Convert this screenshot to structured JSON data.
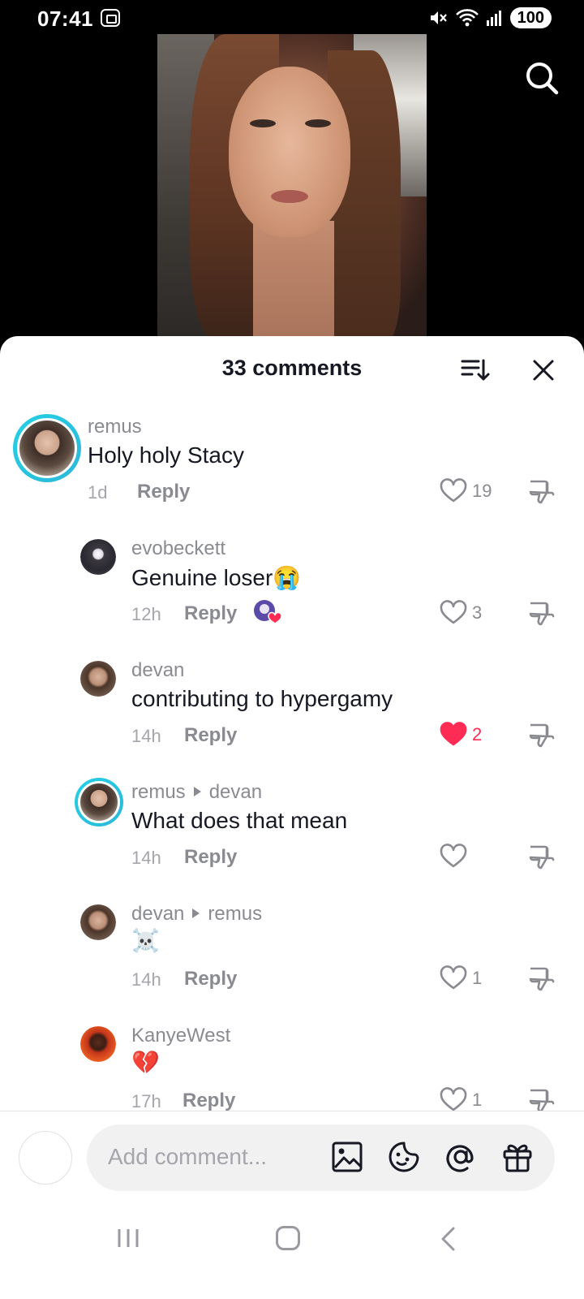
{
  "status_bar": {
    "time": "07:41",
    "battery": "100"
  },
  "sheet": {
    "title": "33 comments"
  },
  "comments": [
    {
      "user": "remus",
      "reply_to": "",
      "text": "Holy holy Stacy",
      "time": "1d",
      "reply_label": "Reply",
      "likes": "19",
      "liked": false
    },
    {
      "user": "evobeckett",
      "reply_to": "",
      "text": "Genuine loser😭",
      "time": "12h",
      "reply_label": "Reply",
      "likes": "3",
      "liked": false
    },
    {
      "user": "devan",
      "reply_to": "",
      "text": "contributing to hypergamy",
      "time": "14h",
      "reply_label": "Reply",
      "likes": "2",
      "liked": true
    },
    {
      "user": "remus",
      "reply_to": "devan",
      "text": "What does that mean",
      "time": "14h",
      "reply_label": "Reply",
      "likes": "",
      "liked": false
    },
    {
      "user": "devan",
      "reply_to": "remus",
      "text": "☠️",
      "time": "14h",
      "reply_label": "Reply",
      "likes": "1",
      "liked": false
    },
    {
      "user": "KanyeWest",
      "reply_to": "",
      "text": "💔",
      "time": "17h",
      "reply_label": "Reply",
      "likes": "1",
      "liked": false
    }
  ],
  "input": {
    "placeholder": "Add comment..."
  },
  "colors": {
    "accent_red": "#fe2c55",
    "ring_cyan": "#25d0e6"
  }
}
